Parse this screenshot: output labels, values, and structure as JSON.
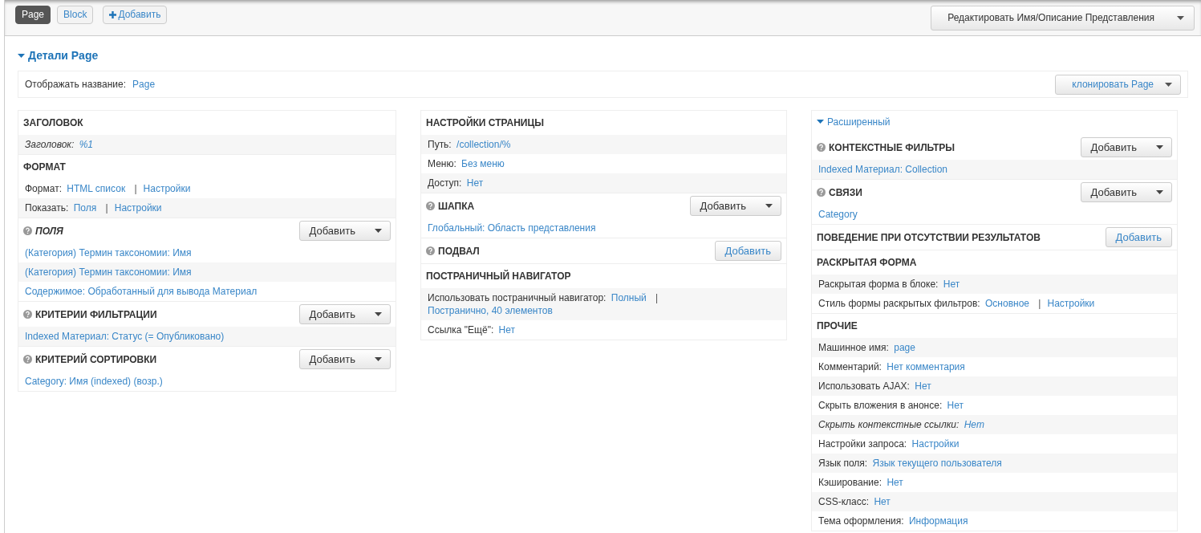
{
  "tabs": [
    {
      "label": "Page",
      "selected": true
    },
    {
      "label": "Block",
      "selected": false
    }
  ],
  "add_display_button": {
    "label": "Добавить"
  },
  "edit_button": {
    "label": "Редактировать Имя/Описание Представления"
  },
  "details": {
    "title": "Детали Page",
    "expanded": true,
    "display_name": {
      "label": "Отображать название:",
      "value": "Page"
    },
    "clone_button": {
      "label": "клонировать Page"
    }
  },
  "columns": [
    {
      "sections": [
        {
          "title": "ЗАГОЛОВОК",
          "help": false,
          "overridden": false,
          "rows": [
            {
              "kind": "setting",
              "label": "Заголовок:",
              "values": [
                "%1"
              ],
              "overridden": true
            }
          ]
        },
        {
          "title": "ФОРМАТ",
          "help": false,
          "overridden": false,
          "rows": [
            {
              "kind": "setting",
              "label": "Формат:",
              "values": [
                "HTML список",
                "Настройки"
              ],
              "separator": "|",
              "overridden": false
            },
            {
              "kind": "setting",
              "label": "Показать:",
              "values": [
                "Поля",
                "Настройки"
              ],
              "separator": "|",
              "overridden": false
            }
          ]
        },
        {
          "title": "ПОЛЯ",
          "help": true,
          "overridden": true,
          "add_button": {
            "label": "Добавить",
            "dropdown": true
          },
          "rows": [
            {
              "kind": "item",
              "text": "(Категория) Термин таксономии: Имя",
              "overridden": false
            },
            {
              "kind": "item",
              "text": "(Категория) Термин таксономии: Имя",
              "overridden": false
            },
            {
              "kind": "item",
              "text": "Содержимое: Обработанный для вывода Материал",
              "overridden": false
            }
          ]
        },
        {
          "title": "КРИТЕРИИ ФИЛЬТРАЦИИ",
          "help": true,
          "overridden": false,
          "add_button": {
            "label": "Добавить",
            "dropdown": true
          },
          "rows": [
            {
              "kind": "item",
              "text": "Indexed Материал: Статус (= Опубликовано)",
              "overridden": false
            }
          ]
        },
        {
          "title": "КРИТЕРИЙ СОРТИРОВКИ",
          "help": true,
          "overridden": false,
          "add_button": {
            "label": "Добавить",
            "dropdown": true
          },
          "rows": [
            {
              "kind": "item",
              "text": "Category: Имя (indexed) (возр.)",
              "overridden": false
            }
          ]
        }
      ]
    },
    {
      "sections": [
        {
          "title": "НАСТРОЙКИ СТРАНИЦЫ",
          "help": false,
          "overridden": false,
          "rows": [
            {
              "kind": "setting",
              "label": "Путь:",
              "values": [
                "/collection/%"
              ],
              "overridden": false
            },
            {
              "kind": "setting",
              "label": "Меню:",
              "values": [
                "Без меню"
              ],
              "overridden": false
            },
            {
              "kind": "setting",
              "label": "Доступ:",
              "values": [
                "Нет"
              ],
              "overridden": false
            }
          ]
        },
        {
          "title": "ШАПКА",
          "help": true,
          "overridden": false,
          "add_button": {
            "label": "Добавить",
            "dropdown": true
          },
          "rows": [
            {
              "kind": "item",
              "text": "Глобальный: Область представления",
              "overridden": false
            }
          ]
        },
        {
          "title": "ПОДВАЛ",
          "help": true,
          "overridden": false,
          "add_button": {
            "label": "Добавить",
            "dropdown": false
          }
        },
        {
          "title": "ПОСТРАНИЧНЫЙ НАВИГАТОР",
          "help": false,
          "overridden": false,
          "rows": [
            {
              "kind": "setting",
              "label": "Использовать постраничный навигатор:",
              "values": [
                "Полный",
                "Постранично, 40 элементов"
              ],
              "separator": "|",
              "overridden": false
            },
            {
              "kind": "setting",
              "label": "Ссылка \"Ещё\":",
              "values": [
                "Нет"
              ],
              "overridden": false
            }
          ]
        }
      ]
    },
    {
      "toggle": {
        "label": "Расширенный",
        "expanded": true
      },
      "sections": [
        {
          "title": "КОНТЕКСТНЫЕ ФИЛЬТРЫ",
          "help": true,
          "overridden": false,
          "add_button": {
            "label": "Добавить",
            "dropdown": true
          },
          "rows": [
            {
              "kind": "item",
              "text": "Indexed Материал: Collection",
              "overridden": false
            }
          ]
        },
        {
          "title": "СВЯЗИ",
          "help": true,
          "overridden": false,
          "add_button": {
            "label": "Добавить",
            "dropdown": true
          },
          "rows": [
            {
              "kind": "item",
              "text": "Category",
              "overridden": false
            }
          ]
        },
        {
          "title": "ПОВЕДЕНИЕ ПРИ ОТСУТСТВИИ РЕЗУЛЬТАТОВ",
          "help": false,
          "overridden": false,
          "add_button": {
            "label": "Добавить",
            "dropdown": false
          }
        },
        {
          "title": "РАСКРЫТАЯ ФОРМА",
          "help": false,
          "overridden": false,
          "rows": [
            {
              "kind": "setting",
              "label": "Раскрытая форма в блоке:",
              "values": [
                "Нет"
              ],
              "overridden": false
            },
            {
              "kind": "setting",
              "label": "Стиль формы раскрытых фильтров:",
              "values": [
                "Основное",
                "Настройки"
              ],
              "separator": "|",
              "overridden": false
            }
          ]
        },
        {
          "title": "ПРОЧИЕ",
          "help": false,
          "overridden": false,
          "rows": [
            {
              "kind": "setting",
              "label": "Машинное имя:",
              "values": [
                "page"
              ],
              "overridden": false
            },
            {
              "kind": "setting",
              "label": "Комментарий:",
              "values": [
                "Нет комментария"
              ],
              "overridden": false
            },
            {
              "kind": "setting",
              "label": "Использовать AJAX:",
              "values": [
                "Нет"
              ],
              "overridden": false
            },
            {
              "kind": "setting",
              "label": "Скрыть вложения в анонсе:",
              "values": [
                "Нет"
              ],
              "overridden": false
            },
            {
              "kind": "setting",
              "label": "Скрыть контекстные ссылки:",
              "values": [
                "Нет"
              ],
              "overridden": true
            },
            {
              "kind": "setting",
              "label": "Настройки запроса:",
              "values": [
                "Настройки"
              ],
              "overridden": false
            },
            {
              "kind": "setting",
              "label": "Язык поля:",
              "values": [
                "Язык текущего пользователя"
              ],
              "overridden": false
            },
            {
              "kind": "setting",
              "label": "Кэширование:",
              "values": [
                "Нет"
              ],
              "overridden": false
            },
            {
              "kind": "setting",
              "label": "CSS-класс:",
              "values": [
                "Нет"
              ],
              "overridden": false
            },
            {
              "kind": "setting",
              "label": "Тема оформления:",
              "values": [
                "Информация"
              ],
              "overridden": false
            }
          ]
        }
      ]
    }
  ]
}
